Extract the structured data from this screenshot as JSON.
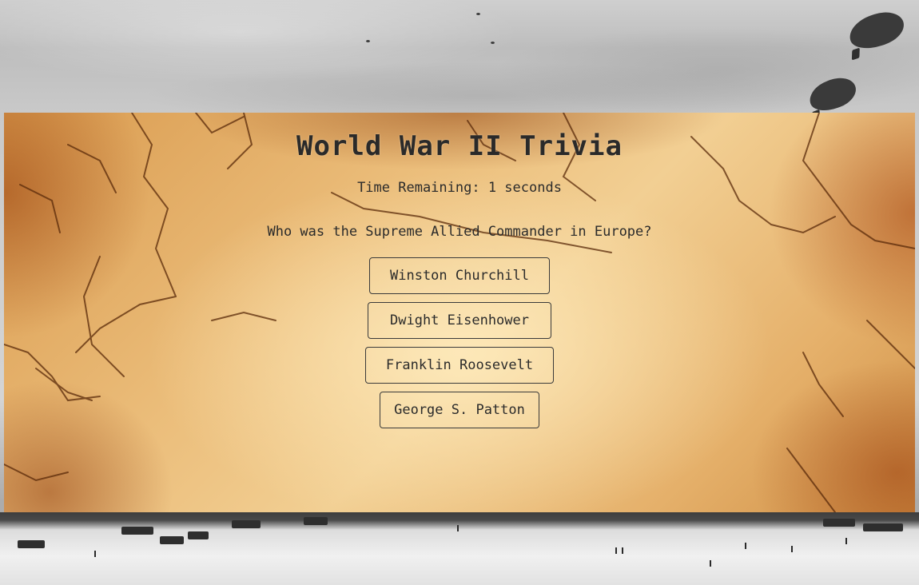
{
  "quiz": {
    "title": "World War II Trivia",
    "timer_text": "Time Remaining: 1 seconds",
    "question": "Who was the Supreme Allied Commander in Europe?",
    "answers": [
      "Winston Churchill",
      "Dwight Eisenhower",
      "Franklin Roosevelt",
      "George S. Patton"
    ]
  },
  "colors": {
    "text": "#2b2b2b",
    "parchment": "#ebbd7a",
    "button_border": "#3a3a3a"
  },
  "icons": [
    "barrage-balloon-icon"
  ]
}
